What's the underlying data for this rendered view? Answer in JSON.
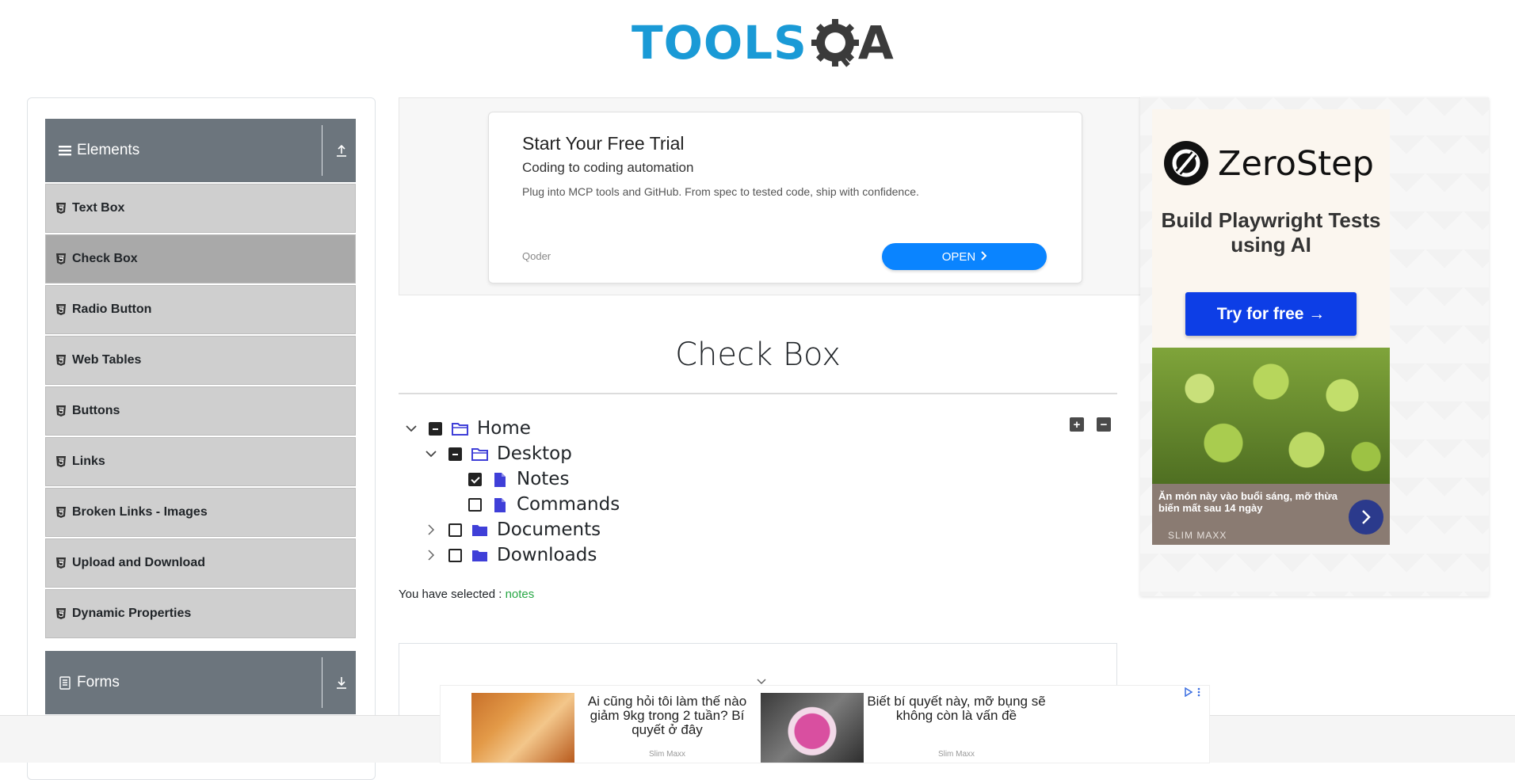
{
  "header": {
    "logo_text_1": "TOOLS",
    "logo_text_2": "A"
  },
  "sidebar": {
    "groups": [
      {
        "title": "Elements",
        "expanded": true
      },
      {
        "title": "Forms",
        "expanded": false
      }
    ],
    "items": [
      {
        "label": "Text Box"
      },
      {
        "label": "Check Box",
        "active": true
      },
      {
        "label": "Radio Button"
      },
      {
        "label": "Web Tables"
      },
      {
        "label": "Buttons"
      },
      {
        "label": "Links"
      },
      {
        "label": "Broken Links - Images"
      },
      {
        "label": "Upload and Download"
      },
      {
        "label": "Dynamic Properties"
      }
    ]
  },
  "top_ad": {
    "title": "Start Your Free Trial",
    "subtitle": "Coding to coding automation",
    "description": "Plug into MCP tools and GitHub. From spec to tested code, ship with confidence.",
    "brand": "Qoder",
    "button": "OPEN"
  },
  "right_ad": {
    "brand": "ZeroStep",
    "tagline": "Build Playwright Tests using AI",
    "button": "Try for free →",
    "caption": "Ăn món này vào buổi sáng, mỡ thừa biến mất sau 14 ngày",
    "caption_brand": "SLIM MAXX"
  },
  "main": {
    "title": "Check Box",
    "tree": {
      "home": "Home",
      "desktop": "Desktop",
      "notes": "Notes",
      "commands": "Commands",
      "documents": "Documents",
      "downloads": "Downloads"
    },
    "expand_all": "+",
    "collapse_all": "−",
    "result_prefix": "You have selected :",
    "result_value": "notes"
  },
  "bottom_ad": {
    "items": [
      {
        "text": "Ai cũng hỏi tôi làm thế nào giảm 9kg trong 2 tuần? Bí quyết ở đây",
        "brand": "Slim Maxx"
      },
      {
        "text": "Biết bí quyết này, mỡ bụng sẽ không còn là vấn đề",
        "brand": "Slim Maxx"
      }
    ]
  },
  "colors": {
    "accent_blue": "#1a9ad6",
    "sidebar_header": "#6c757d",
    "menu_bg": "#cfcfcf",
    "menu_active": "#a9a9a9",
    "success_green": "#28a745",
    "folder_blue": "#3f3fd8"
  }
}
